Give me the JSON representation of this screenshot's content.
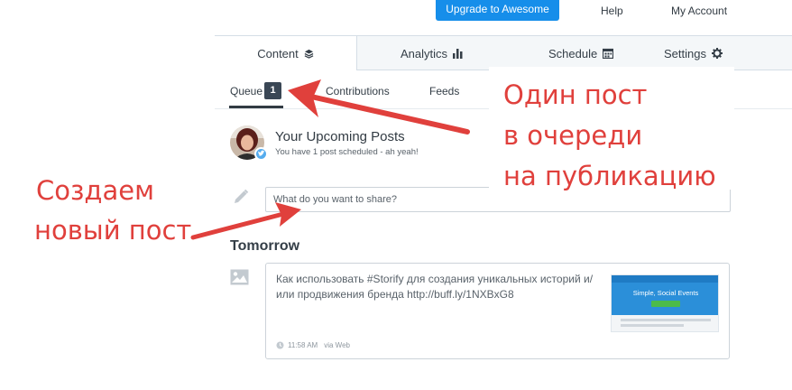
{
  "header": {
    "upgrade_label": "Upgrade to Awesome",
    "help_label": "Help",
    "account_label": "My Account"
  },
  "tabs": [
    {
      "label": "Content",
      "icon": "layers-icon",
      "active": true
    },
    {
      "label": "Analytics",
      "icon": "bar-chart-icon",
      "active": false
    },
    {
      "label": "Schedule",
      "icon": "calendar-icon",
      "active": false
    },
    {
      "label": "Settings",
      "icon": "gear-icon",
      "active": false
    }
  ],
  "subtabs": {
    "queue_label": "Queue",
    "queue_count": "1",
    "contributions_label": "Contributions",
    "feeds_label": "Feeds"
  },
  "profile": {
    "title": "Your Upcoming Posts",
    "subtitle": "You have 1 post scheduled - ah yeah!",
    "network_icon": "twitter-icon"
  },
  "composer": {
    "placeholder": "What do you want to share?"
  },
  "queue": {
    "day_heading": "Tomorrow",
    "post": {
      "text": "Как использовать #Storify для создания уникальных историй и/или продвижения бренда http://buff.ly/1NXBxG8",
      "thumbnail_text": "Simple, Social Events",
      "time": "11:58 AM",
      "via": "via Web"
    }
  },
  "annotations": {
    "right_line1": "Один пост",
    "right_line2": "в очереди",
    "right_line3": "на публикацию",
    "left_line1": "Создаем",
    "left_line2": "новый пост",
    "color": "#e0403c"
  },
  "colors": {
    "accent": "#168eea",
    "badge": "#3a4755",
    "twitter": "#55acee"
  }
}
